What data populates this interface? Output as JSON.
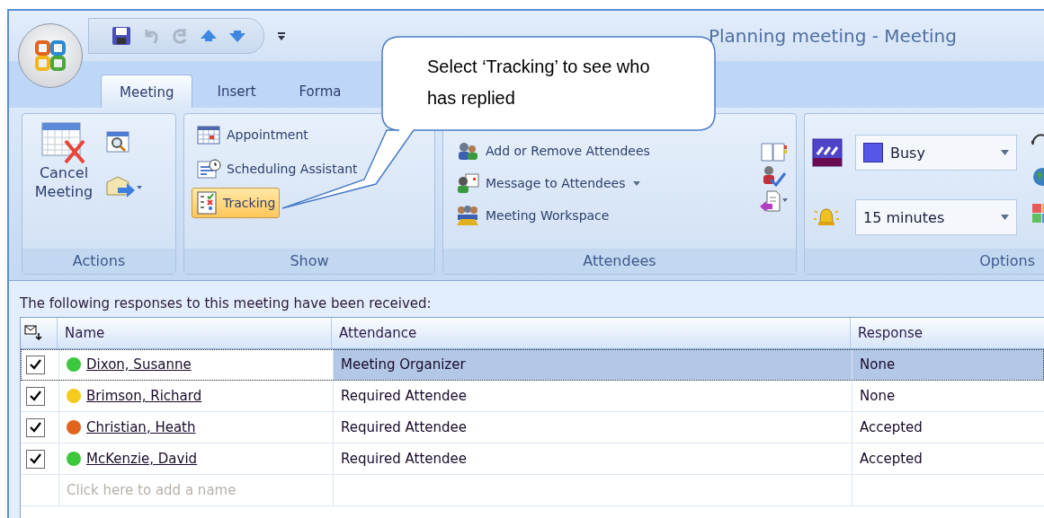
{
  "window": {
    "title": "Planning meeting - Meeting"
  },
  "tabs": [
    {
      "label": "Meeting",
      "selected": true
    },
    {
      "label": "Insert",
      "selected": false
    },
    {
      "label": "Forma",
      "selected": false
    }
  ],
  "callout": {
    "text": "Select ‘Tracking’ to see who has replied"
  },
  "actions": {
    "label": "Actions",
    "cancel": "Cancel Meeting"
  },
  "show": {
    "label": "Show",
    "buttons": [
      {
        "label": "Appointment",
        "selected": false
      },
      {
        "label": "Scheduling Assistant",
        "selected": false
      },
      {
        "label": "Tracking",
        "selected": true
      }
    ]
  },
  "attendees": {
    "label": "Attendees",
    "buttons": [
      {
        "label": "Add or Remove Attendees",
        "dropdown": false
      },
      {
        "label": "Message to Attendees",
        "dropdown": true
      },
      {
        "label": "Meeting Workspace",
        "dropdown": false
      }
    ]
  },
  "options": {
    "label": "Options",
    "show_as": "Busy",
    "reminder": "15 minutes"
  },
  "tracking": {
    "intro": "The following responses to this meeting have been received:",
    "columns": [
      "Name",
      "Attendance",
      "Response"
    ],
    "rows": [
      {
        "checked": true,
        "color": "#3cc83c",
        "name": "Dixon, Susanne",
        "attendance": "Meeting Organizer",
        "response": "None",
        "selected": true
      },
      {
        "checked": true,
        "color": "#f5cc1e",
        "name": "Brimson, Richard",
        "attendance": "Required Attendee",
        "response": "None",
        "selected": false
      },
      {
        "checked": true,
        "color": "#e0641e",
        "name": "Christian, Heath",
        "attendance": "Required Attendee",
        "response": "Accepted",
        "selected": false
      },
      {
        "checked": true,
        "color": "#3cc83c",
        "name": "McKenzie, David",
        "attendance": "Required Attendee",
        "response": "Accepted",
        "selected": false
      }
    ],
    "add_placeholder": "Click here to add a name"
  }
}
